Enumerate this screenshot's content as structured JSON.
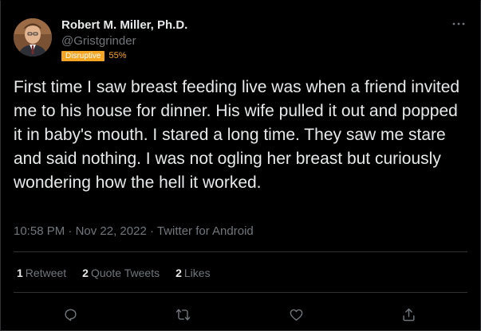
{
  "author": {
    "display_name": "Robert M. Miller, Ph.D.",
    "handle": "@Gristgrinder",
    "badge_label": "Disruptive",
    "badge_percent": "55%",
    "avatar_icon": "profile-photo"
  },
  "tweet": {
    "text": "First time I saw breast feeding live was when a friend invited me to his house for dinner. His wife pulled it out and popped it in baby's mouth. I stared a long time. They saw me stare and said nothing. I was not ogling her breast but curiously wondering how the hell it worked."
  },
  "meta": {
    "time": "10:58 PM",
    "separator1": " · ",
    "date": "Nov 22, 2022",
    "separator2": " · ",
    "source": "Twitter for Android"
  },
  "stats": {
    "retweets_count": "1",
    "retweets_label": "Retweet",
    "quotes_count": "2",
    "quotes_label": "Quote Tweets",
    "likes_count": "2",
    "likes_label": "Likes"
  },
  "actions": {
    "reply_icon": "reply-icon",
    "retweet_icon": "retweet-icon",
    "like_icon": "heart-icon",
    "share_icon": "share-icon",
    "more_icon": "more-icon"
  },
  "colors": {
    "background": "#000000",
    "text_primary": "#e7e9ea",
    "text_secondary": "#71767b",
    "divider": "#2f3336",
    "badge": "#f6a623"
  }
}
